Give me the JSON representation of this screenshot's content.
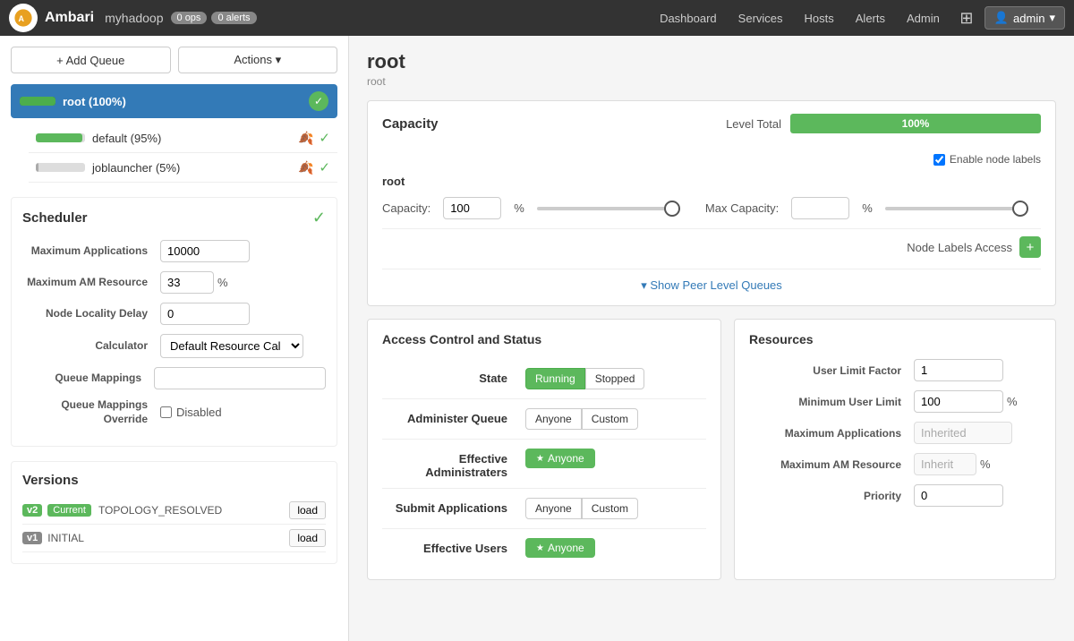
{
  "topnav": {
    "brand": "Ambari",
    "cluster": "myhadoop",
    "ops_badge": "0 ops",
    "alerts_badge": "0 alerts",
    "nav_items": [
      "Dashboard",
      "Services",
      "Hosts",
      "Alerts",
      "Admin"
    ],
    "user_label": "admin"
  },
  "sidebar": {
    "add_queue_label": "+ Add Queue",
    "actions_label": "Actions ▾",
    "queues": {
      "root": {
        "label": "root (100%)",
        "progress": 100,
        "children": [
          {
            "label": "default (95%)",
            "progress": 95
          },
          {
            "label": "joblauncher (5%)",
            "progress": 5
          }
        ]
      }
    },
    "scheduler": {
      "title": "Scheduler",
      "fields": [
        {
          "label": "Maximum Applications",
          "value": "10000",
          "type": "text",
          "unit": ""
        },
        {
          "label": "Maximum AM Resource",
          "value": "33",
          "type": "text",
          "unit": "%"
        },
        {
          "label": "Node Locality Delay",
          "value": "0",
          "type": "text",
          "unit": ""
        },
        {
          "label": "Calculator",
          "value": "Default Resource Cal",
          "type": "select"
        },
        {
          "label": "Queue Mappings",
          "value": "",
          "type": "text"
        },
        {
          "label": "Queue Mappings Override",
          "value": "Disabled",
          "type": "checkbox"
        }
      ]
    },
    "versions": {
      "title": "Versions",
      "items": [
        {
          "badge": "v2",
          "current": true,
          "name": "TOPOLOGY_RESOLVED",
          "action": "load"
        },
        {
          "badge": "v1",
          "current": false,
          "name": "INITIAL",
          "action": "load"
        }
      ]
    }
  },
  "content": {
    "title": "root",
    "subtitle": "root",
    "capacity_section": {
      "label": "Capacity",
      "level_total_label": "Level Total",
      "level_total_percent": "100%",
      "level_total_bar_width": 100,
      "enable_node_labels": "Enable node labels",
      "root_queue_label": "root",
      "capacity_label": "Capacity:",
      "capacity_value": "100",
      "capacity_unit": "%",
      "max_capacity_label": "Max Capacity:",
      "max_capacity_value": "",
      "max_capacity_unit": "%",
      "node_labels_access_label": "Node Labels Access",
      "show_peer_queues_label": "▾ Show Peer Level Queues"
    },
    "access_section": {
      "title": "Access Control and Status",
      "state_label": "State",
      "state_running": "Running",
      "state_stopped": "Stopped",
      "administer_label": "Administer Queue",
      "administer_anyone": "Anyone",
      "administer_custom": "Custom",
      "effective_admin_label": "Effective Administraters",
      "effective_admin_value": "★ Anyone",
      "submit_label": "Submit Applications",
      "submit_anyone": "Anyone",
      "submit_custom": "Custom",
      "effective_users_label": "Effective Users",
      "effective_users_value": "★ Anyone"
    },
    "resources_section": {
      "title": "Resources",
      "fields": [
        {
          "label": "User Limit Factor",
          "value": "1",
          "type": "normal"
        },
        {
          "label": "Minimum User Limit",
          "value": "100",
          "type": "normal",
          "unit": "%"
        },
        {
          "label": "Maximum Applications",
          "value": "Inherited",
          "type": "inherited"
        },
        {
          "label": "Maximum AM Resource",
          "value": "Inherit",
          "type": "inherited",
          "unit": "%"
        },
        {
          "label": "Priority",
          "value": "0",
          "type": "normal"
        }
      ]
    }
  }
}
